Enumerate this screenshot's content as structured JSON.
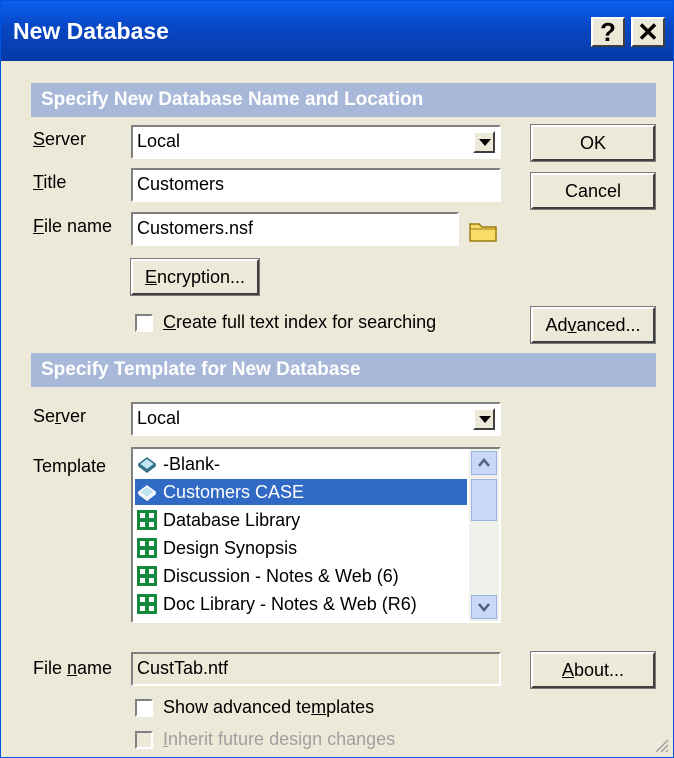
{
  "window": {
    "title": "New Database",
    "help_label": "?",
    "close_label": "✕"
  },
  "location": {
    "header": "Specify New Database Name and Location",
    "server_label": "Server",
    "server_value": "Local",
    "title_label": "Title",
    "title_value": "Customers",
    "filename_label": "File name",
    "filename_value": "Customers.nsf",
    "encryption_button": "Encryption...",
    "fulltext_label": "Create full text index for searching",
    "fulltext_checked": false
  },
  "buttons": {
    "ok": "OK",
    "cancel": "Cancel",
    "advanced": "Advanced...",
    "about": "About..."
  },
  "template": {
    "header": "Specify Template for New Database",
    "server_label": "Server",
    "server_value": "Local",
    "template_label": "Template",
    "items": [
      {
        "label": "-Blank-",
        "icon": "blank-database-icon",
        "selected": false
      },
      {
        "label": "Customers CASE",
        "icon": "blank-database-icon",
        "selected": true
      },
      {
        "label": "Database Library",
        "icon": "notes-template-icon",
        "selected": false
      },
      {
        "label": "Design Synopsis",
        "icon": "notes-template-icon",
        "selected": false
      },
      {
        "label": "Discussion - Notes & Web (6)",
        "icon": "notes-template-icon",
        "selected": false
      },
      {
        "label": "Doc Library - Notes & Web (R6)",
        "icon": "notes-template-icon",
        "selected": false
      }
    ],
    "filename_label": "File name",
    "filename_value": "CustTab.ntf",
    "show_advanced_label": "Show advanced templates",
    "inherit_label": "Inherit future design changes"
  },
  "colors": {
    "title_bar": "#0846c2",
    "section_header": "#a8b8d8",
    "selection": "#316ac5",
    "dialog_bg": "#ece9d8"
  }
}
